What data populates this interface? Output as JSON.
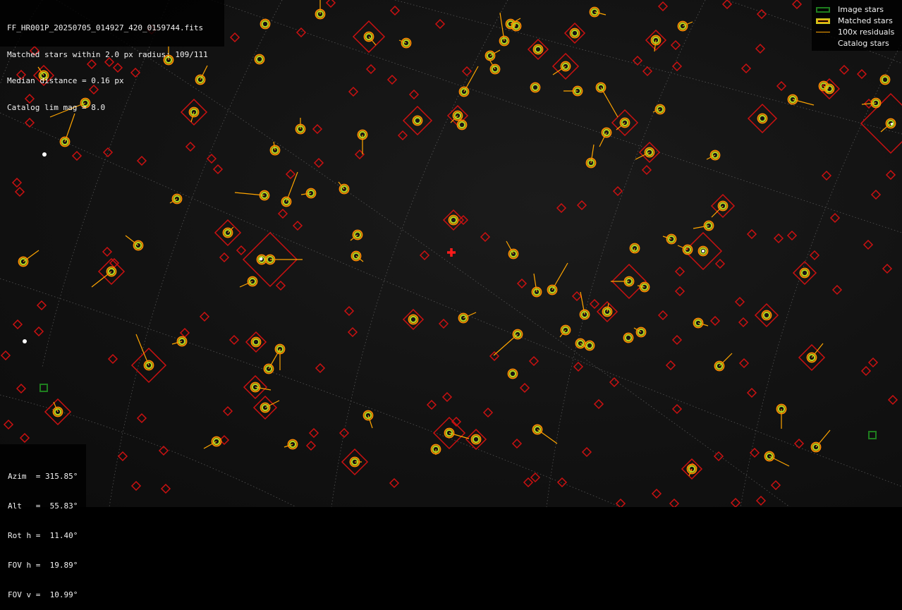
{
  "header": {
    "filename": "FF_HR001P_20250705_014927_420_0159744.fits",
    "matched_summary": "Matched stars within 2.0 px radius: 109/111",
    "median_distance": "Median distance = 0.16 px",
    "catalog_limit": "Catalog lim mag = 8.0"
  },
  "legend": {
    "items": [
      {
        "label": "Image stars",
        "color": "#1e7d1e"
      },
      {
        "label": "Matched stars",
        "color": "#c8c81e"
      },
      {
        "label": "100x residuals",
        "color": "#ffa500"
      },
      {
        "label": "Catalog stars",
        "color": "#cc1111"
      }
    ]
  },
  "pointing": {
    "azim": "Azim  = 315.85°",
    "alt": "Alt   =  55.83°",
    "rot": "Rot h =  11.40°",
    "fov_h": "FOV h =  19.89°",
    "fov_v": "FOV v =  10.99°"
  },
  "colors": {
    "catalog": "#cc1111",
    "matched_outer": "#ff8c00",
    "matched_inner": "#b4d21e",
    "residual": "#ffa500",
    "image_star": "#1e7d1e",
    "center_cross": "#ff1a1a",
    "grid": "#707070"
  }
}
